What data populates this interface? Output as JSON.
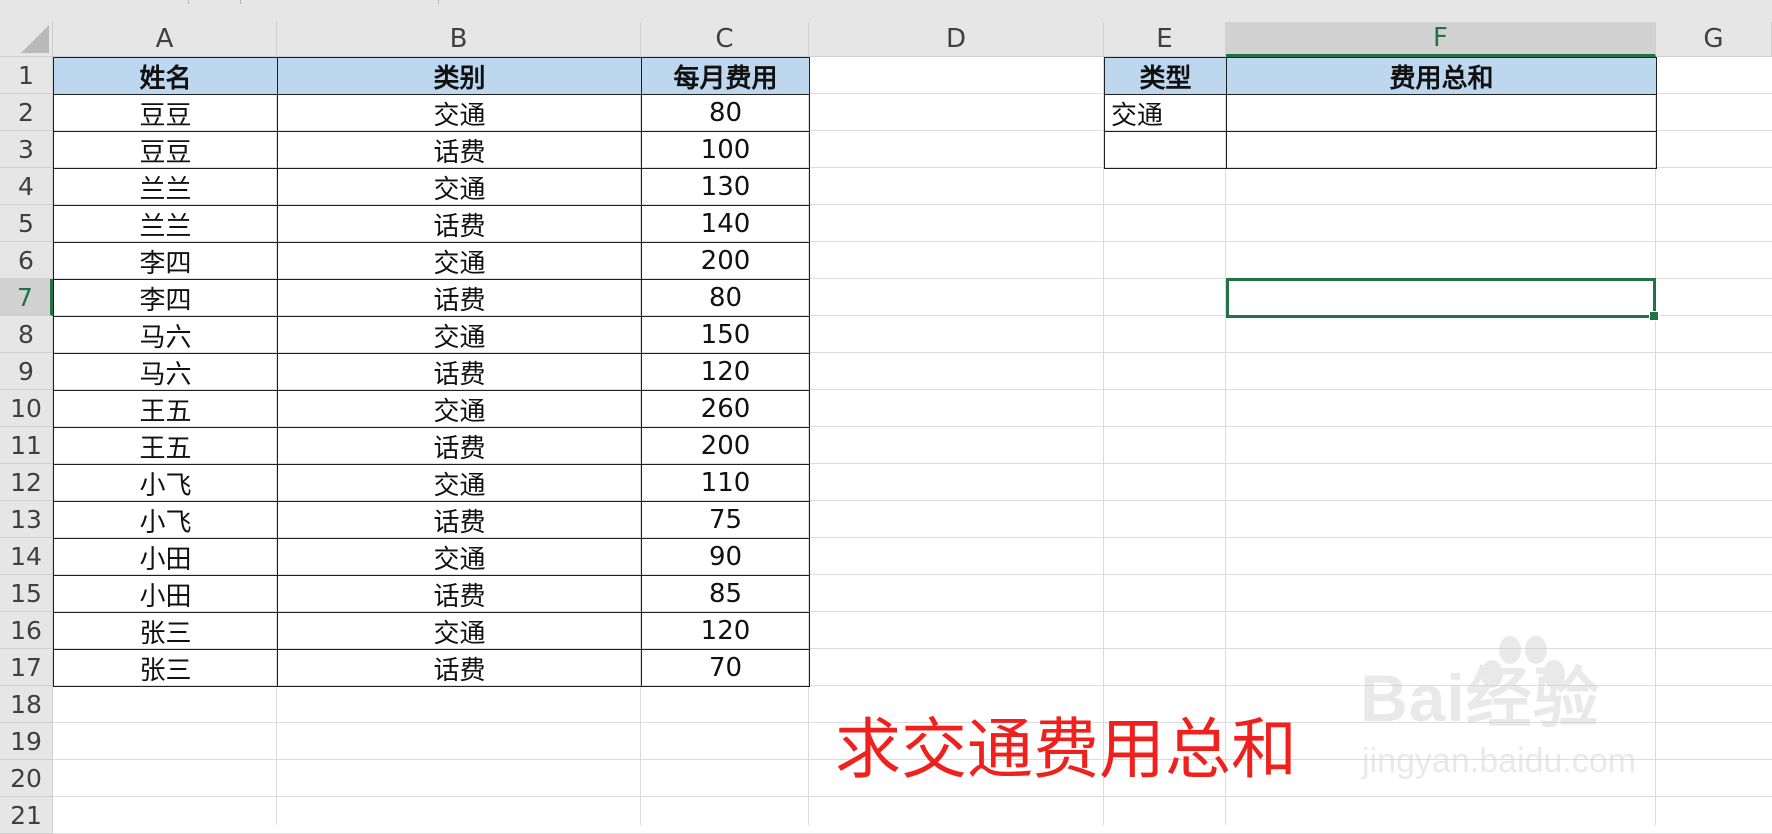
{
  "columns": [
    "A",
    "B",
    "C",
    "D",
    "E",
    "F",
    "G"
  ],
  "rows": [
    "1",
    "2",
    "3",
    "4",
    "5",
    "6",
    "7",
    "8",
    "9",
    "10",
    "11",
    "12",
    "13",
    "14",
    "15",
    "16",
    "17",
    "18",
    "19",
    "20",
    "21"
  ],
  "table": {
    "headers": [
      "姓名",
      "类别",
      "每月费用"
    ],
    "data": [
      [
        "豆豆",
        "交通",
        "80"
      ],
      [
        "豆豆",
        "话费",
        "100"
      ],
      [
        "兰兰",
        "交通",
        "130"
      ],
      [
        "兰兰",
        "话费",
        "140"
      ],
      [
        "李四",
        "交通",
        "200"
      ],
      [
        "李四",
        "话费",
        "80"
      ],
      [
        "马六",
        "交通",
        "150"
      ],
      [
        "马六",
        "话费",
        "120"
      ],
      [
        "王五",
        "交通",
        "260"
      ],
      [
        "王五",
        "话费",
        "200"
      ],
      [
        "小飞",
        "交通",
        "110"
      ],
      [
        "小飞",
        "话费",
        "75"
      ],
      [
        "小田",
        "交通",
        "90"
      ],
      [
        "小田",
        "话费",
        "85"
      ],
      [
        "张三",
        "交通",
        "120"
      ],
      [
        "张三",
        "话费",
        "70"
      ]
    ]
  },
  "summary": {
    "headers": [
      "类型",
      "费用总和"
    ],
    "rows": [
      [
        "交通",
        ""
      ],
      [
        "",
        ""
      ]
    ]
  },
  "selection": {
    "active_cell": "F7",
    "selected_column": "F",
    "selected_row": "7"
  },
  "annotation": "求交通费用总和",
  "watermark": {
    "brand": "Bai经验",
    "url": "jingyan.baidu.com"
  },
  "colors": {
    "header_fill": "#bdd7ee",
    "selection": "#217346",
    "annotation": "#f0201d"
  }
}
